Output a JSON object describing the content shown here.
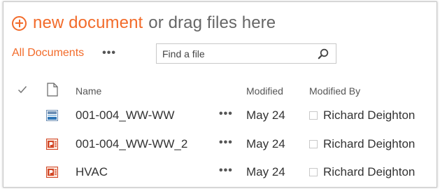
{
  "toolbar": {
    "new_document_label": "new document",
    "drag_text": "or drag files here"
  },
  "views": {
    "active_view": "All Documents",
    "more_label": "•••"
  },
  "search": {
    "placeholder": "Find a file"
  },
  "columns": {
    "name": "Name",
    "modified": "Modified",
    "modified_by": "Modified By"
  },
  "rows": [
    {
      "icon": "image-file-icon",
      "name": "001-004_WW-WW",
      "more": "•••",
      "modified": "May 24",
      "modified_by": "Richard Deighton"
    },
    {
      "icon": "powerpoint-file-icon",
      "name": "001-004_WW-WW_2",
      "more": "•••",
      "modified": "May 24",
      "modified_by": "Richard Deighton"
    },
    {
      "icon": "powerpoint-file-icon",
      "name": "HVAC",
      "more": "•••",
      "modified": "May 24",
      "modified_by": "Richard Deighton"
    }
  ],
  "colors": {
    "accent": "#f26b2a",
    "text": "#333333",
    "muted": "#666666"
  }
}
